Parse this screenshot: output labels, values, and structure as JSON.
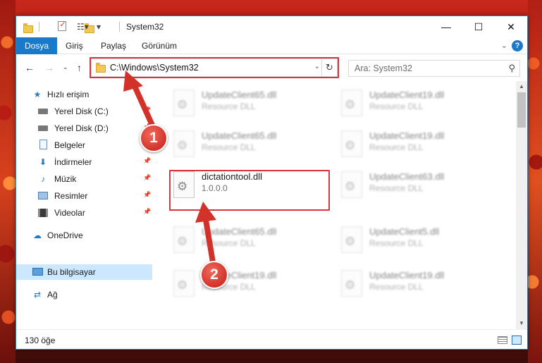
{
  "window": {
    "title": "System32",
    "minimize": "—",
    "maximize": "☐",
    "close": "✕"
  },
  "ribbon": {
    "tabs": [
      "Dosya",
      "Giriş",
      "Paylaş",
      "Görünüm"
    ],
    "active_tab": "Dosya",
    "help_label": "?"
  },
  "navigation": {
    "address": "C:\\Windows\\System32",
    "search_placeholder": "Ara: System32"
  },
  "sidebar": {
    "items": [
      {
        "label": "Hızlı erişim",
        "icon": "star-icon",
        "pinned": false
      },
      {
        "label": "Yerel Disk (C:)",
        "icon": "drive-icon",
        "pinned": true
      },
      {
        "label": "Yerel Disk (D:)",
        "icon": "drive-icon",
        "pinned": true
      },
      {
        "label": "Belgeler",
        "icon": "documents-icon",
        "pinned": true
      },
      {
        "label": "İndirmeler",
        "icon": "download-icon",
        "pinned": true
      },
      {
        "label": "Müzik",
        "icon": "music-icon",
        "pinned": true
      },
      {
        "label": "Resimler",
        "icon": "pictures-icon",
        "pinned": true
      },
      {
        "label": "Videolar",
        "icon": "videos-icon",
        "pinned": true
      },
      {
        "label": "OneDrive",
        "icon": "cloud-icon",
        "pinned": false
      },
      {
        "label": "Bu bilgisayar",
        "icon": "computer-icon",
        "pinned": false,
        "selected": true
      },
      {
        "label": "Ağ",
        "icon": "network-icon",
        "pinned": false
      }
    ]
  },
  "files": [
    {
      "name": "UpdateClient65.dll",
      "desc": "Resource DLL"
    },
    {
      "name": "UpdateClient19.dll",
      "desc": "Resource DLL"
    },
    {
      "name": "UpdateClient65.dll",
      "desc": "Resource DLL"
    },
    {
      "name": "UpdateClient19.dll",
      "desc": "Resource DLL"
    },
    {
      "name": "dictationtool.dll",
      "desc": "1.0.0.0",
      "highlighted": true
    },
    {
      "name": "UpdateClient63.dll",
      "desc": "Resource DLL"
    },
    {
      "name": "UpdateClient65.dll",
      "desc": "Resource DLL"
    },
    {
      "name": "UpdateClient5.dll",
      "desc": "Resource DLL"
    },
    {
      "name": "UpdateClient19.dll",
      "desc": "Resource DLL"
    },
    {
      "name": "UpdateClient19.dll",
      "desc": "Resource DLL"
    }
  ],
  "status": {
    "item_count": "130 öğe"
  },
  "annotations": {
    "step1": "1",
    "step2": "2",
    "color": "#d2322a"
  },
  "colors": {
    "accent": "#1979ca",
    "selection": "#cce8ff",
    "highlight_box": "#d8363c"
  }
}
